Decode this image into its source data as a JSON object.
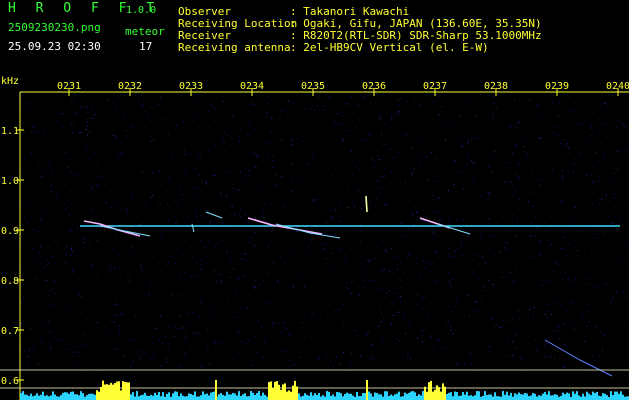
{
  "app": {
    "name": "H R O F F T",
    "version": "1.0.0"
  },
  "file": {
    "name": "2509230230.png",
    "datetime": "25.09.23 02:30"
  },
  "meteor": {
    "label": "meteor",
    "count": "17"
  },
  "info": [
    {
      "key": "Observer",
      "value": ": Takanori Kawachi"
    },
    {
      "key": "Receiving Location",
      "value": ": Ogaki, Gifu, JAPAN (136.60E, 35.35N)"
    },
    {
      "key": "Receiver",
      "value": ": R820T2(RTL-SDR) SDR-Sharp 53.1000MHz"
    },
    {
      "key": "Receiving antenna",
      "value": ": 2el-HB9CV Vertical (el. E-W)"
    }
  ],
  "axis": {
    "unit": "kHz",
    "time_ticks": [
      "0231",
      "0232",
      "0233",
      "0234",
      "0235",
      "0236",
      "0237",
      "0238",
      "0239",
      "0240"
    ],
    "freq_ticks": [
      "1.1",
      "1.0",
      "0.9",
      "0.8",
      "0.7",
      "0.6"
    ]
  },
  "colors": {
    "background": "#000000",
    "signal": "#39d6ff",
    "axis_text": "#ffff33",
    "header_green": "#33ff33"
  }
}
